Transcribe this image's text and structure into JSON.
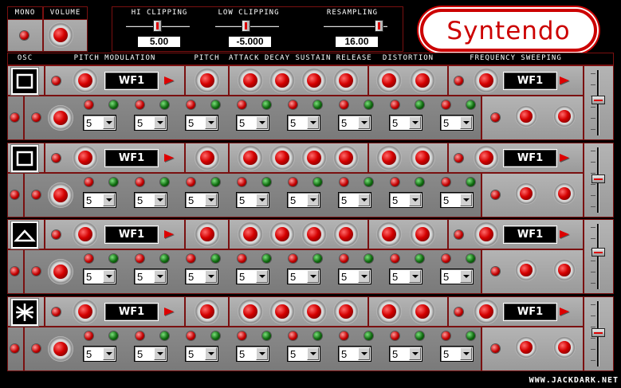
{
  "app": {
    "title": "Syntendo",
    "credit": "WWW.JACKDARK.NET"
  },
  "colors": {
    "accent": "#cc0000",
    "panel": "#a8a8a8",
    "frame": "#7a1010"
  },
  "top": {
    "mono_label": "MONO",
    "volume_label": "VOLUME",
    "hi_clipping": {
      "label": "HI CLIPPING",
      "value": "5.00"
    },
    "low_clipping": {
      "label": "LOW CLIPPING",
      "value": "-5.000"
    },
    "resampling": {
      "label": "RESAMPLING",
      "value": "16.00"
    }
  },
  "headers": {
    "osc": "OSC",
    "pitch_mod": "PITCH MODULATION",
    "pitch": "PITCH",
    "adsr": "ATTACK DECAY SUSTAIN RELEASE",
    "distortion": "DISTORTION",
    "freq_sweep": "FREQUENCY SWEEPING"
  },
  "oscillators": [
    {
      "icon": "square-wave-icon",
      "pitch_mod_wave": "WF1",
      "sweep_wave": "WF1",
      "dropdowns": [
        "5",
        "5",
        "5",
        "5",
        "5",
        "5",
        "5",
        "5"
      ]
    },
    {
      "icon": "square-wave-icon",
      "pitch_mod_wave": "WF1",
      "sweep_wave": "WF1",
      "dropdowns": [
        "5",
        "5",
        "5",
        "5",
        "5",
        "5",
        "5",
        "5"
      ]
    },
    {
      "icon": "triangle-wave-icon",
      "pitch_mod_wave": "WF1",
      "sweep_wave": "WF1",
      "dropdowns": [
        "5",
        "5",
        "5",
        "5",
        "5",
        "5",
        "5",
        "5"
      ]
    },
    {
      "icon": "noise-wave-icon",
      "pitch_mod_wave": "WF1",
      "sweep_wave": "WF1",
      "dropdowns": [
        "5",
        "5",
        "5",
        "5",
        "5",
        "5",
        "5",
        "5"
      ]
    }
  ]
}
